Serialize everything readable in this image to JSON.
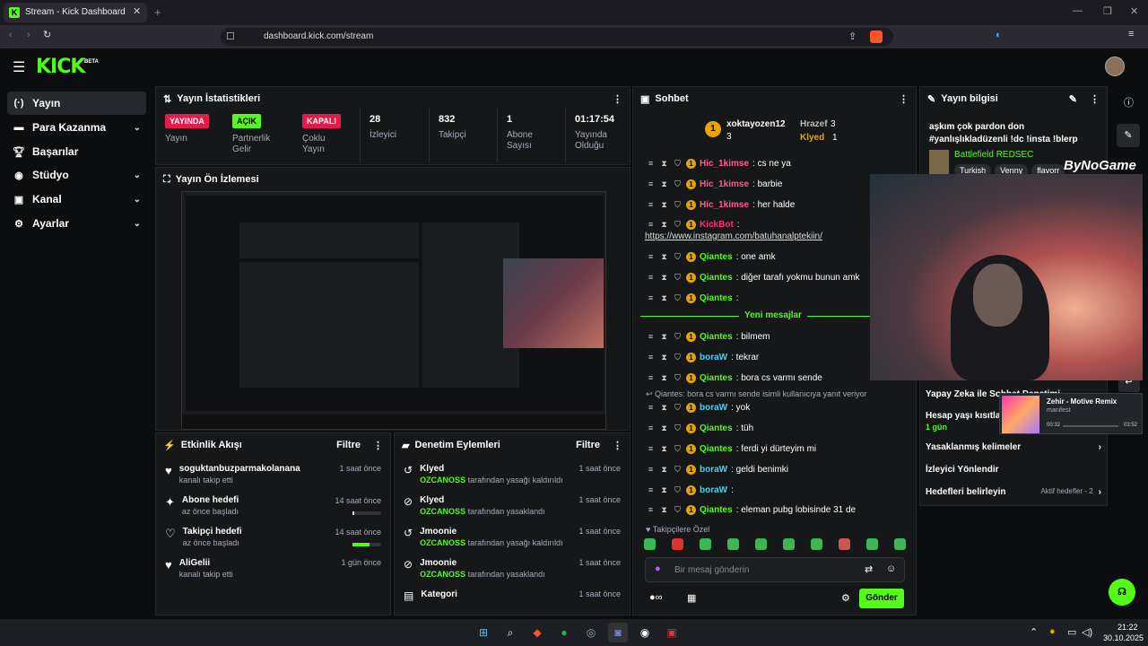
{
  "browser": {
    "tab_title": "Stream - Kick Dashboard",
    "url": "dashboard.kick.com/stream"
  },
  "app": {
    "logo": "KICK",
    "logo_badge": "BETA"
  },
  "sidebar": {
    "items": [
      {
        "label": "Yayın",
        "icon": "broadcast-icon"
      },
      {
        "label": "Para Kazanma",
        "icon": "money-icon"
      },
      {
        "label": "Başarılar",
        "icon": "trophy-icon"
      },
      {
        "label": "Stüdyo",
        "icon": "camera-icon"
      },
      {
        "label": "Kanal",
        "icon": "chat-icon"
      },
      {
        "label": "Ayarlar",
        "icon": "gear-icon"
      }
    ]
  },
  "stats": {
    "title": "Yayın İstatistikleri",
    "items": [
      {
        "badge": "YAYINDA",
        "label": "Yayın"
      },
      {
        "badge": "AÇIK",
        "label": "Partnerlik Gelir"
      },
      {
        "badge": "KAPALI",
        "label": "Çoklu Yayın"
      },
      {
        "value": "28",
        "label": "İzleyici"
      },
      {
        "value": "832",
        "label": "Takipçi"
      },
      {
        "value": "1",
        "label": "Abone Sayısı"
      },
      {
        "value": "01:17:54",
        "label": "Yayında Olduğu"
      }
    ]
  },
  "preview": {
    "title": "Yayın Ön İzlemesi"
  },
  "activity": {
    "title": "Etkinlik Akışı",
    "filter": "Filtre",
    "rows": [
      {
        "title": "soguktanbuzparmakolanana",
        "sub": "kanalı takip etti",
        "time": "1 saat önce",
        "icon": "heart-icon"
      },
      {
        "title": "Abone hedefi",
        "sub": "az önce başladı",
        "time": "14 saat önce",
        "icon": "sparkle-icon",
        "progress": 0.05
      },
      {
        "title": "Takipçi hedefi",
        "sub": "az önce başladı",
        "time": "14 saat önce",
        "icon": "heart-outline-icon",
        "progress": 0.4
      },
      {
        "title": "AliGelii",
        "sub": "kanalı takip etti",
        "time": "1 gün önce",
        "icon": "heart-icon"
      }
    ]
  },
  "moderation": {
    "title": "Denetim Eylemleri",
    "filter": "Filtre",
    "rows": [
      {
        "title": "Klyed",
        "mod": "OZCANOSS",
        "sub": "tarafından yasağı kaldırıldı",
        "time": "1 saat önce",
        "icon": "undo-icon"
      },
      {
        "title": "Klyed",
        "mod": "OZCANOSS",
        "sub": "tarafından yasaklandı",
        "time": "1 saat önce",
        "icon": "ban-icon"
      },
      {
        "title": "Jmoonie",
        "mod": "OZCANOSS",
        "sub": "tarafından yasağı kaldırıldı",
        "time": "1 saat önce",
        "icon": "undo-icon"
      },
      {
        "title": "Jmoonie",
        "mod": "OZCANOSS",
        "sub": "tarafından yasaklandı",
        "time": "1 saat önce",
        "icon": "ban-icon"
      },
      {
        "title": "Kategori",
        "mod": "",
        "sub": "",
        "time": "1 saat önce",
        "icon": "category-icon"
      }
    ]
  },
  "chat": {
    "title": "Sohbet",
    "top_user": "xoktayozen12",
    "top_count": "3",
    "second_user": "Hrazef",
    "second_count": "3",
    "third_user": "Klyed",
    "third_count": "1",
    "messages": [
      {
        "user": "Hic_1kimse",
        "text": ": cs ne ya",
        "color": "#ff5c8a"
      },
      {
        "user": "Hic_1kimse",
        "text": ": barbie",
        "color": "#ff5c8a"
      },
      {
        "user": "Hic_1kimse",
        "text": ": her halde",
        "color": "#ff5c8a"
      },
      {
        "user": "KickBot",
        "text": ":",
        "color": "#ff2d6f"
      },
      {
        "user": "Qiantes",
        "text": ": one amk",
        "color": "#53fc18"
      },
      {
        "user": "Qiantes",
        "text": ": diğer tarafı yokmu bunun amk",
        "color": "#53fc18"
      },
      {
        "user": "Qiantes",
        "text": ":",
        "color": "#53fc18"
      },
      {
        "user": "Qiantes",
        "text": ": bilmem",
        "color": "#53fc18"
      },
      {
        "user": "boraW",
        "text": ": tekrar",
        "color": "#3dd6f5"
      },
      {
        "user": "Qiantes",
        "text": ": bora cs varmı sende",
        "color": "#53fc18"
      },
      {
        "user": "boraW",
        "text": ": yok",
        "color": "#3dd6f5"
      },
      {
        "user": "Qiantes",
        "text": ": tüh",
        "color": "#53fc18"
      },
      {
        "user": "Qiantes",
        "text": ": ferdi yi dürteyim mi",
        "color": "#53fc18"
      },
      {
        "user": "boraW",
        "text": ": geldi benimki",
        "color": "#3dd6f5"
      },
      {
        "user": "boraW",
        "text": ":",
        "color": "#3dd6f5"
      },
      {
        "user": "Qiantes",
        "text": ": eleman pubg lobisinde 31 de",
        "color": "#53fc18"
      }
    ],
    "link": "https://www.instagram.com/batuhanalptekiin/",
    "new_messages": "Yeni mesajlar",
    "reply_note": "Qiantes: bora cs varmı sende isimli kullanıcıya yanıt veriyor",
    "followers_only": "Takipçilere Özel",
    "input_placeholder": "Bir mesaj gönderin",
    "send": "Gönder"
  },
  "info": {
    "title": "Yayın bilgisi",
    "stream_title": "aşkım çok pardon don #yanlışlıkladüzenli !dc !insta !blerp",
    "category": "Battlefield REDSEC",
    "tags": [
      "Turkish",
      "Venny",
      "flavorr"
    ],
    "bynogame": "ByNoGame",
    "items": [
      {
        "label": "Yapay Zeka ile Sohbet Denetimi"
      },
      {
        "label": "Hesap yaşı kısıtlaması",
        "sub": "1 gün"
      },
      {
        "label": "Yasaklanmış kelimeler"
      },
      {
        "label": "İzleyici Yönlendir"
      },
      {
        "label": "Hedefleri belirleyin",
        "extra": "Aktif hedefler - 2"
      }
    ]
  },
  "media": {
    "song": "Zehir - Motive Remix",
    "artist": "manifest",
    "elapsed": "00:32",
    "total": "03:52"
  },
  "taskbar": {
    "time": "21:22",
    "date": "30.10.2025"
  }
}
